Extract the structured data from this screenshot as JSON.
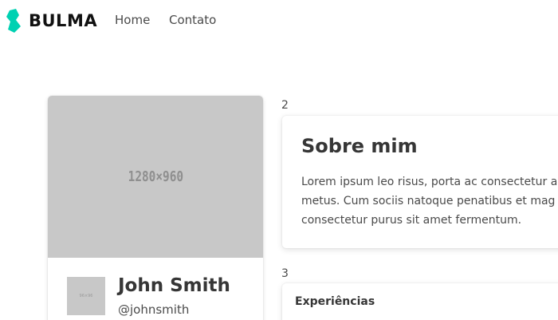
{
  "navbar": {
    "brand": "BULMA",
    "brand_color": "#00d1b2",
    "links": [
      {
        "label": "Home"
      },
      {
        "label": "Contato"
      }
    ]
  },
  "profile": {
    "image_placeholder": "1280×960",
    "avatar_placeholder": "96×96",
    "name": "John Smith",
    "handle": "@johnsmith"
  },
  "sections": {
    "about_number": "2",
    "experiences_number": "3"
  },
  "about": {
    "title": "Sobre mim",
    "lines": [
      "Lorem ipsum leo risus, porta ac consectetur a",
      "metus. Cum sociis natoque penatibus et mag",
      "consectetur purus sit amet fermentum."
    ]
  },
  "experiences": {
    "title": "Experiências"
  }
}
